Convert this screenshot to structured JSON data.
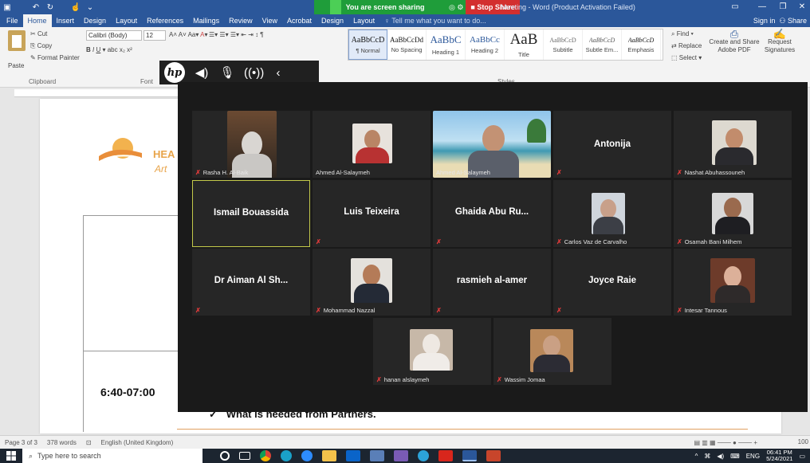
{
  "titlebar": {
    "share_banner": "You are screen sharing",
    "stop_share": "Stop Share",
    "doc_title": "Meeting - Word (Product Activation Failed)"
  },
  "tabs": [
    "File",
    "Home",
    "Insert",
    "Design",
    "Layout",
    "References",
    "Mailings",
    "Review",
    "View",
    "Acrobat",
    "Design",
    "Layout"
  ],
  "active_tab": "Home",
  "tell_me": "Tell me what you want to do...",
  "sign_in": "Sign in",
  "share": "Share",
  "ribbon": {
    "cut": "Cut",
    "copy": "Copy",
    "format_painter": "Format Painter",
    "paste": "Paste",
    "clipboard_label": "Clipboard",
    "font_label": "Font",
    "font_name": "Calibri (Body)",
    "font_size": "12",
    "styles_label": "Styles",
    "styles": [
      {
        "sample": "AaBbCcD",
        "name": "¶ Normal"
      },
      {
        "sample": "AaBbCcDd",
        "name": "No Spacing"
      },
      {
        "sample": "AaBbC",
        "name": "Heading 1"
      },
      {
        "sample": "AaBbCc",
        "name": "Heading 2"
      },
      {
        "sample": "AaB",
        "name": "Title"
      },
      {
        "sample": "AaBbCcD",
        "name": "Subtitle"
      },
      {
        "sample": "AaBbCcD",
        "name": "Subtle Em..."
      },
      {
        "sample": "AaBbCcD",
        "name": "Emphasis"
      }
    ],
    "find": "Find",
    "replace": "Replace",
    "select": "Select",
    "create_share_pdf": "Create and Share Adobe PDF",
    "request_signatures": "Request Signatures"
  },
  "document": {
    "logo_text": "HEA",
    "logo_sub": "Art",
    "time": "6:40-07:00",
    "bullet": "What is needed from Partners."
  },
  "participants": [
    {
      "name": "Rasha H. Al-Baik",
      "type": "video",
      "muted": true
    },
    {
      "name": "Ahmed Al-Salaymeh",
      "type": "video",
      "muted": false
    },
    {
      "name": "Ahmed Al-Salaymeh",
      "type": "video-wide",
      "muted": false
    },
    {
      "name": "Antonija",
      "type": "text",
      "muted": true
    },
    {
      "name": "Nashat Abuhassouneh",
      "type": "video",
      "muted": true
    },
    {
      "name": "Ismail Bouassida",
      "type": "text",
      "muted": false,
      "speaker": true
    },
    {
      "name": "Luis Teixeira",
      "type": "text",
      "muted": true
    },
    {
      "name": "Ghaida Abu Ru...",
      "type": "text",
      "muted": true
    },
    {
      "name": "Carlos Vaz de Carvalho",
      "type": "video",
      "muted": true
    },
    {
      "name": "Osamah Bani Milhem",
      "type": "video",
      "muted": true
    },
    {
      "name": "Dr Aiman Al Sh...",
      "type": "text",
      "muted": true
    },
    {
      "name": "Mohammad Nazzal",
      "type": "video",
      "muted": true
    },
    {
      "name": "rasmieh al-amer",
      "type": "text",
      "muted": true
    },
    {
      "name": "Joyce Raie",
      "type": "text",
      "muted": true
    },
    {
      "name": "Intesar Tannous",
      "type": "video",
      "muted": true
    },
    {
      "name": "hanan alslaymeh",
      "type": "video",
      "muted": true
    },
    {
      "name": "Wassim Jomaa",
      "type": "video",
      "muted": true
    }
  ],
  "status": {
    "page": "Page 3 of 3",
    "words": "378 words",
    "language": "English (United Kingdom)",
    "zoom": "100"
  },
  "taskbar": {
    "search_placeholder": "Type here to search",
    "lang": "ENG",
    "time": "06:41 PM",
    "date": "5/24/2021"
  },
  "colors": {
    "word_blue": "#2b579a",
    "share_green": "#1f9d3a",
    "stop_red": "#d32f2f",
    "active_speaker": "#c3c94a",
    "mute_red": "#e03b3b"
  }
}
